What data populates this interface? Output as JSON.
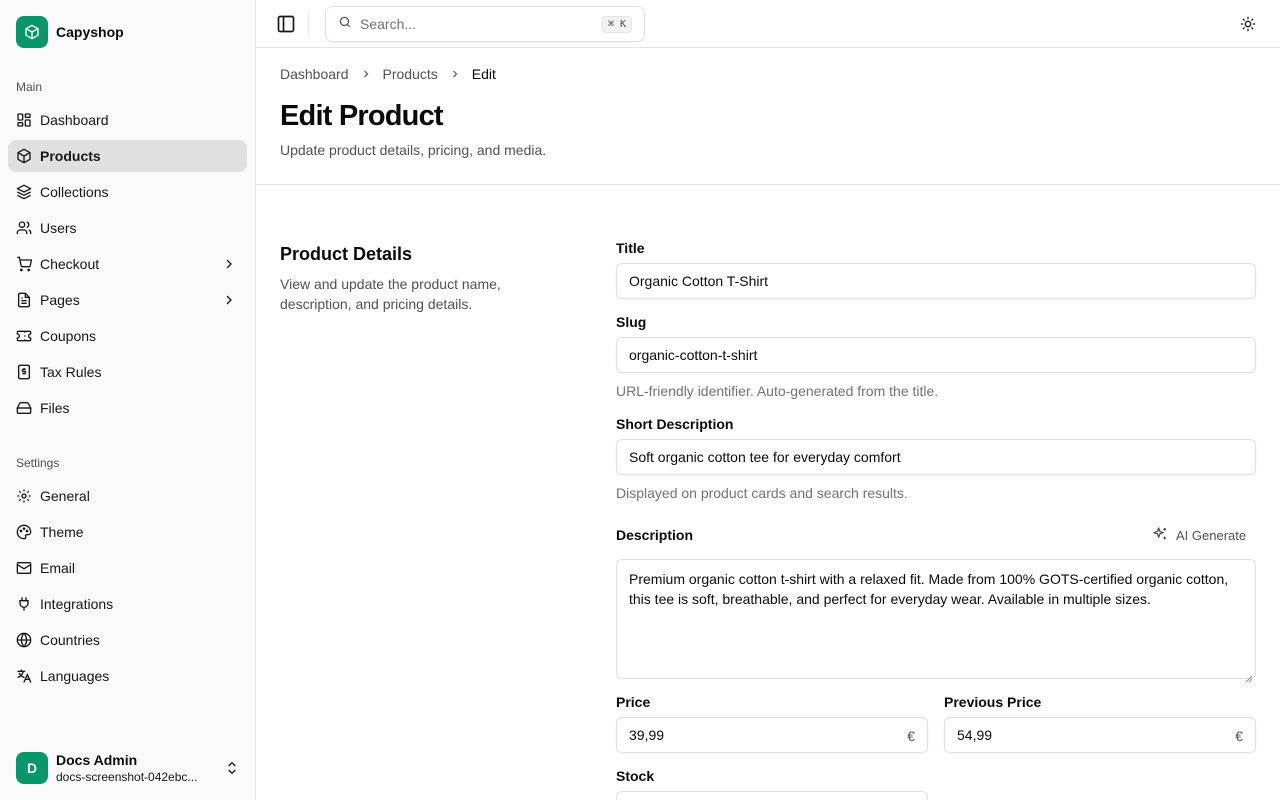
{
  "brand": {
    "name": "Capyshop",
    "accent": "#059669"
  },
  "sidebar": {
    "main_label": "Main",
    "main_items": [
      {
        "label": "Dashboard",
        "icon": "dashboard-icon"
      },
      {
        "label": "Products",
        "icon": "box-icon",
        "active": true
      },
      {
        "label": "Collections",
        "icon": "layers-icon"
      },
      {
        "label": "Users",
        "icon": "users-icon"
      },
      {
        "label": "Checkout",
        "icon": "cart-icon",
        "expandable": true
      },
      {
        "label": "Pages",
        "icon": "file-icon",
        "expandable": true
      },
      {
        "label": "Coupons",
        "icon": "ticket-icon"
      },
      {
        "label": "Tax Rules",
        "icon": "receipt-icon"
      },
      {
        "label": "Files",
        "icon": "hard-drive-icon"
      }
    ],
    "settings_label": "Settings",
    "settings_items": [
      {
        "label": "General",
        "icon": "gear-icon"
      },
      {
        "label": "Theme",
        "icon": "palette-icon"
      },
      {
        "label": "Email",
        "icon": "mail-icon"
      },
      {
        "label": "Integrations",
        "icon": "plug-icon"
      },
      {
        "label": "Countries",
        "icon": "globe-icon"
      },
      {
        "label": "Languages",
        "icon": "languages-icon"
      }
    ],
    "user": {
      "initial": "D",
      "name": "Docs Admin",
      "email": "docs-screenshot-042ebc..."
    }
  },
  "header": {
    "search": {
      "placeholder": "Search...",
      "shortcut": "⌘ K"
    }
  },
  "breadcrumb": [
    "Dashboard",
    "Products",
    "Edit"
  ],
  "page": {
    "title": "Edit Product",
    "subtitle": "Update product details, pricing, and media."
  },
  "section": {
    "title": "Product Details",
    "description": "View and update the product name, description, and pricing details."
  },
  "form": {
    "title": {
      "label": "Title",
      "value": "Organic Cotton T-Shirt"
    },
    "slug": {
      "label": "Slug",
      "value": "organic-cotton-t-shirt",
      "help": "URL-friendly identifier. Auto-generated from the title."
    },
    "short_description": {
      "label": "Short Description",
      "value": "Soft organic cotton tee for everyday comfort",
      "help": "Displayed on product cards and search results."
    },
    "description": {
      "label": "Description",
      "ai_button": "AI Generate",
      "value": "Premium organic cotton t-shirt with a relaxed fit. Made from 100% GOTS-certified organic cotton, this tee is soft, breathable, and perfect for everyday wear. Available in multiple sizes."
    },
    "price": {
      "label": "Price",
      "value": "39,99",
      "currency": "€"
    },
    "previous_price": {
      "label": "Previous Price",
      "value": "54,99",
      "currency": "€"
    },
    "stock": {
      "label": "Stock"
    }
  }
}
